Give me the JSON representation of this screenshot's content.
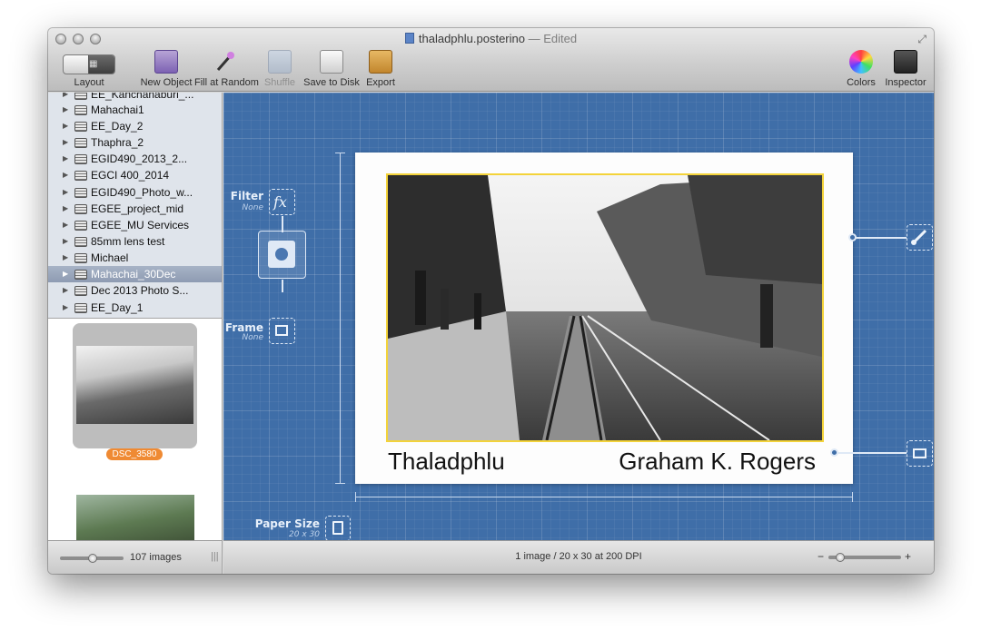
{
  "window": {
    "title": "thaladphlu.posterino",
    "edited": "— Edited"
  },
  "toolbar": {
    "layout": "Layout",
    "new_object": "New Object",
    "fill_at_random": "Fill at Random",
    "shuffle": "Shuffle",
    "save_to_disk": "Save to Disk",
    "export": "Export",
    "colors": "Colors",
    "inspector": "Inspector"
  },
  "sidebar": {
    "items": [
      {
        "label": "EE_Kanchanaburi_..."
      },
      {
        "label": "Mahachai1"
      },
      {
        "label": "EE_Day_2"
      },
      {
        "label": "Thaphra_2"
      },
      {
        "label": "EGID490_2013_2..."
      },
      {
        "label": "EGCI 400_2014"
      },
      {
        "label": "EGID490_Photo_w..."
      },
      {
        "label": "EGEE_project_mid"
      },
      {
        "label": "EGEE_MU Services"
      },
      {
        "label": "85mm lens test"
      },
      {
        "label": "Michael"
      },
      {
        "label": "Mahachai_30Dec"
      },
      {
        "label": "Dec 2013 Photo S..."
      },
      {
        "label": "EE_Day_1"
      }
    ],
    "selected_index": 11,
    "thumb_badge": "DSC_3580",
    "image_count": "107 images"
  },
  "canvas": {
    "filter_label": "Filter",
    "filter_value": "None",
    "frame_label": "Frame",
    "frame_value": "None",
    "paper_size_label": "Paper Size",
    "paper_size_value": "20 x 30",
    "poster_left_text": "Thaladphlu",
    "poster_right_text": "Graham K. Rogers",
    "status": "1 image / 20 x 30 at 200 DPI",
    "zoom_minus": "−",
    "zoom_plus": "+"
  },
  "colors": {
    "canvas_blue": "#3f6ea8",
    "frame_yellow": "#f3d33a",
    "badge_orange": "#ef8a33"
  }
}
